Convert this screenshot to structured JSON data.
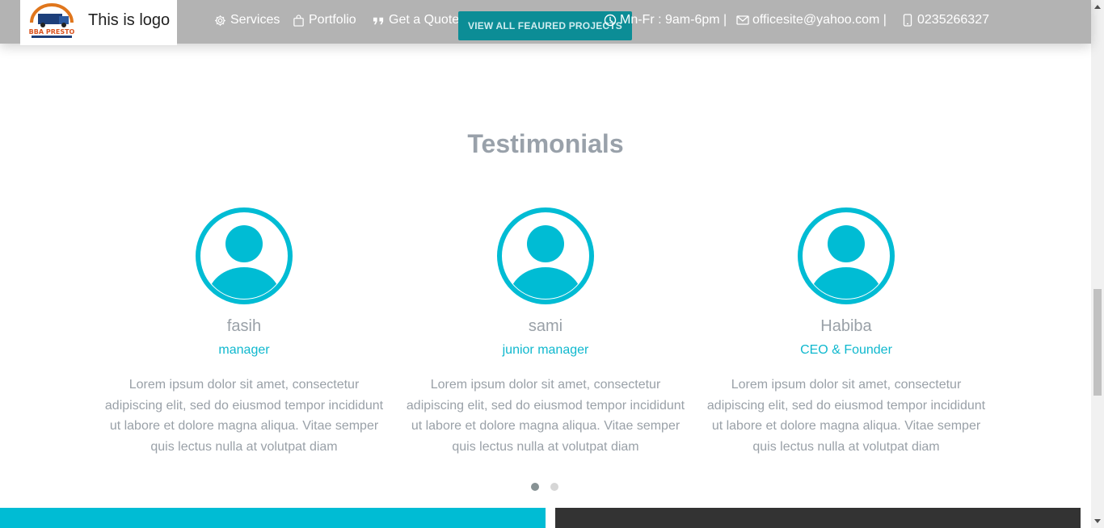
{
  "header": {
    "logo_text": "This is logo",
    "logo_emblem_text": "BBA PRESTO",
    "nav": [
      {
        "label": "Services",
        "icon": "gear-icon"
      },
      {
        "label": "Portfolio",
        "icon": "bag-icon"
      },
      {
        "label": "Get a Quote",
        "icon": "quote-icon"
      }
    ],
    "cta_label": "VIEW ALL FEAURED PROJECTS",
    "contact": {
      "hours": "Mn-Fr : 9am-6pm |",
      "email": "officesite@yahoo.com |",
      "phone": "0235266327"
    }
  },
  "testimonials": {
    "title": "Testimonials",
    "items": [
      {
        "name": "fasih",
        "role": "manager",
        "text": "Lorem ipsum dolor sit amet, consectetur adipiscing elit, sed do eiusmod tempor incididunt ut labore et dolore magna aliqua. Vitae semper quis lectus nulla at volutpat diam"
      },
      {
        "name": "sami",
        "role": "junior manager",
        "text": "Lorem ipsum dolor sit amet, consectetur adipiscing elit, sed do eiusmod tempor incididunt ut labore et dolore magna aliqua. Vitae semper quis lectus nulla at volutpat diam"
      },
      {
        "name": "Habiba",
        "role": "CEO & Founder",
        "text": "Lorem ipsum dolor sit amet, consectetur adipiscing elit, sed do eiusmod tempor incididunt ut labore et dolore magna aliqua. Vitae semper quis lectus nulla at volutpat diam"
      }
    ],
    "active_page": 1,
    "page_count": 2
  },
  "colors": {
    "header_bg": "#b3b3b3",
    "accent": "#00bcd4",
    "cta_bg": "#0c8d96",
    "dark_band": "#333333"
  }
}
